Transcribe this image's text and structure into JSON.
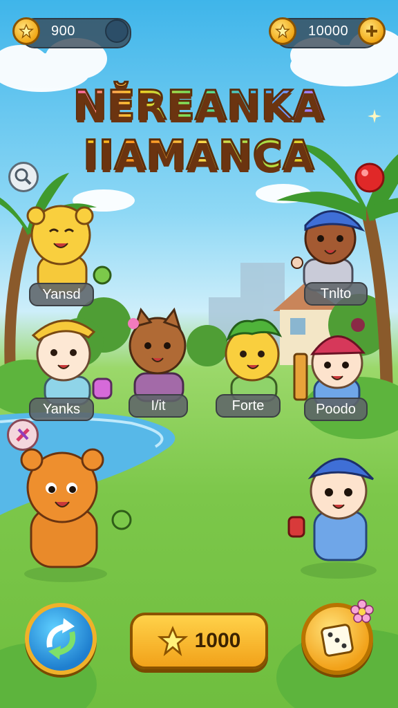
{
  "hud": {
    "left_currency": {
      "value": "900",
      "icon": "star-coin-icon"
    },
    "right_currency": {
      "value": "10000",
      "icon": "star-coin-icon",
      "add_icon": "plus-icon"
    }
  },
  "title": {
    "line1": "NĔREANKA",
    "line2": "IIAMANCA"
  },
  "characters": [
    {
      "label": "Yansd"
    },
    {
      "label": "Yanks"
    },
    {
      "label": "I/it"
    },
    {
      "label": "Forte"
    },
    {
      "label": "Tnlto"
    },
    {
      "label": "Poodo"
    }
  ],
  "bottom_bar": {
    "play_button_label": "1000",
    "left_icon": "refresh-icon",
    "right_icon": "dice-icon"
  },
  "side_buttons": {
    "search_icon": "magnifier-icon",
    "tools_icon": "tools-icon"
  },
  "colors": {
    "sky": "#3fb5ea",
    "grass": "#7cc74a",
    "gold": "#f5b324",
    "label_bg": "#5f6469"
  }
}
